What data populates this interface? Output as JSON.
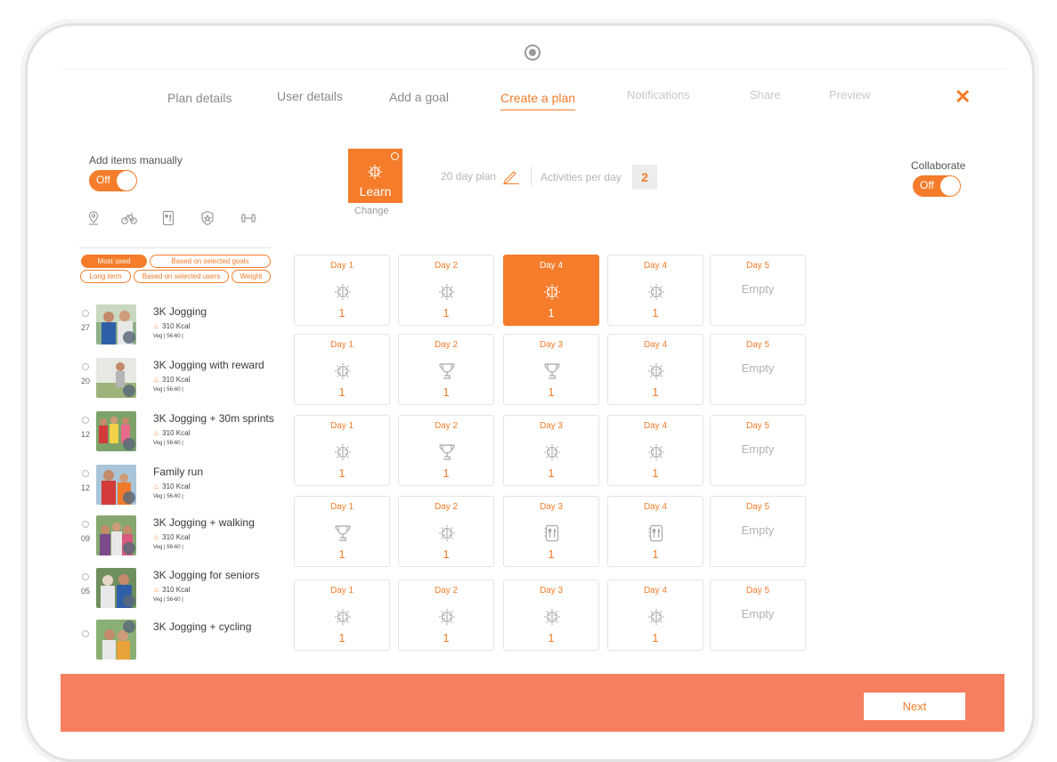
{
  "wizard": {
    "steps": [
      {
        "label": "Plan details",
        "state": "done"
      },
      {
        "label": "User details",
        "state": "done"
      },
      {
        "label": "Add a goal",
        "state": "done"
      },
      {
        "label": "Create a plan",
        "state": "active"
      },
      {
        "label": "Notifications",
        "state": "future"
      },
      {
        "label": "Share",
        "state": "future"
      },
      {
        "label": "Preview",
        "state": "future"
      }
    ],
    "close_icon": "close-icon"
  },
  "manual": {
    "label": "Add items manually",
    "toggle": "Off"
  },
  "collaborate": {
    "label": "Collaborate",
    "toggle": "Off"
  },
  "categories": [
    "location-pin-icon",
    "bicycle-icon",
    "nutrition-icon",
    "reward-badge-icon",
    "dumbbell-icon"
  ],
  "filters": [
    "Most used",
    "Based on selected goals",
    "Long term",
    "Based on selected users",
    "Weight"
  ],
  "activities": [
    {
      "title": "3K Jogging",
      "num": "27",
      "kcal": "310 Kcal",
      "diet": "Veg | 56-60 |"
    },
    {
      "title": "3K Jogging with reward",
      "num": "20",
      "kcal": "310 Kcal",
      "diet": "Veg | 56-60 |"
    },
    {
      "title": "3K Jogging + 30m sprints",
      "num": "12",
      "kcal": "310 Kcal",
      "diet": "Veg | 56-60 |"
    },
    {
      "title": "Family run",
      "num": "12",
      "kcal": "310 Kcal",
      "diet": "Veg | 56-60 |"
    },
    {
      "title": "3K Jogging + walking",
      "num": "09",
      "kcal": "310 Kcal",
      "diet": "Veg | 56-60 |"
    },
    {
      "title": "3K Jogging for seniors",
      "num": "05",
      "kcal": "310 Kcal",
      "diet": "Veg | 56-60 |"
    },
    {
      "title": "3K Jogging + cycling",
      "num": "",
      "kcal": "",
      "diet": ""
    }
  ],
  "plan": {
    "category_label": "Learn",
    "category_icon": "brain-icon",
    "change_label": "Change",
    "length_label": "20 day plan",
    "apd_label": "Activities per day",
    "apd_value": "2"
  },
  "grid": [
    [
      {
        "label": "Day 1",
        "icon": "brain",
        "count": "1"
      },
      {
        "label": "Day 2",
        "icon": "brain",
        "count": "1"
      },
      {
        "label": "Day 4",
        "icon": "brain",
        "count": "1",
        "active": true
      },
      {
        "label": "Day 4",
        "icon": "brain",
        "count": "1"
      },
      {
        "label": "Day 5",
        "empty": "Empty"
      }
    ],
    [
      {
        "label": "Day 1",
        "icon": "brain",
        "count": "1"
      },
      {
        "label": "Day 2",
        "icon": "trophy",
        "count": "1"
      },
      {
        "label": "Day 3",
        "icon": "trophy",
        "count": "1"
      },
      {
        "label": "Day 4",
        "icon": "brain",
        "count": "1"
      },
      {
        "label": "Day 5",
        "empty": "Empty"
      }
    ],
    [
      {
        "label": "Day 1",
        "icon": "brain",
        "count": "1"
      },
      {
        "label": "Day 2",
        "icon": "trophy",
        "count": "1"
      },
      {
        "label": "Day 3",
        "icon": "brain",
        "count": "1"
      },
      {
        "label": "Day 4",
        "icon": "brain",
        "count": "1"
      },
      {
        "label": "Day 5",
        "empty": "Empty"
      }
    ],
    [
      {
        "label": "Day 1",
        "icon": "trophy",
        "count": "1"
      },
      {
        "label": "Day 2",
        "icon": "brain",
        "count": "1"
      },
      {
        "label": "Day 3",
        "icon": "food",
        "count": "1"
      },
      {
        "label": "Day 4",
        "icon": "food",
        "count": "1"
      },
      {
        "label": "Day 5",
        "empty": "Empty"
      }
    ],
    [
      {
        "label": "Day 1",
        "icon": "brain",
        "count": "1"
      },
      {
        "label": "Day 2",
        "icon": "brain",
        "count": "1"
      },
      {
        "label": "Day 3",
        "icon": "brain",
        "count": "1"
      },
      {
        "label": "Day 4",
        "icon": "brain",
        "count": "1"
      },
      {
        "label": "Day 5",
        "empty": "Empty"
      }
    ]
  ],
  "footer": {
    "next_label": "Next"
  },
  "colors": {
    "accent": "#f47c2a",
    "footer": "#f57f5f"
  }
}
